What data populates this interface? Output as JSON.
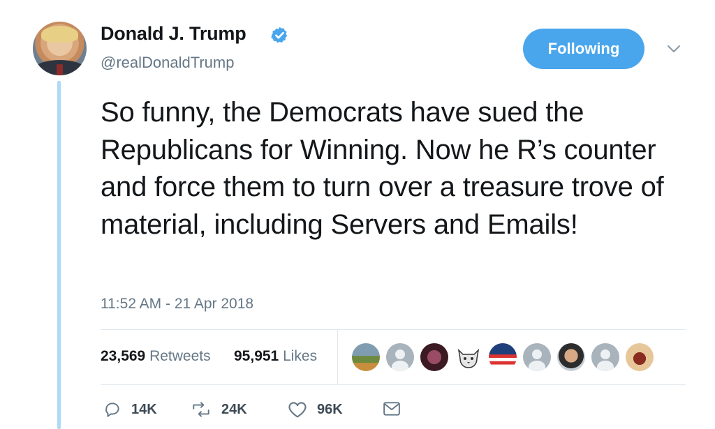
{
  "profile": {
    "name": "Donald J. Trump",
    "handle": "@realDonaldTrump",
    "verified_icon": "verified-badge-icon",
    "follow_label": "Following"
  },
  "tweet": {
    "text": "So funny, the Democrats have sued the Republicans for Winning. Now he R’s counter and force them to turn over a treasure trove of material, including Servers and Emails!",
    "timestamp": "11:52 AM - 21 Apr 2018"
  },
  "stats": {
    "retweets_count": "23,569",
    "retweets_label": "Retweets",
    "likes_count": "95,951",
    "likes_label": "Likes"
  },
  "actions": {
    "replies": "14K",
    "retweets": "24K",
    "likes": "96K"
  },
  "colors": {
    "accent": "#4aa6ec",
    "thread_line": "#afd9f4",
    "muted_text": "#657786"
  }
}
